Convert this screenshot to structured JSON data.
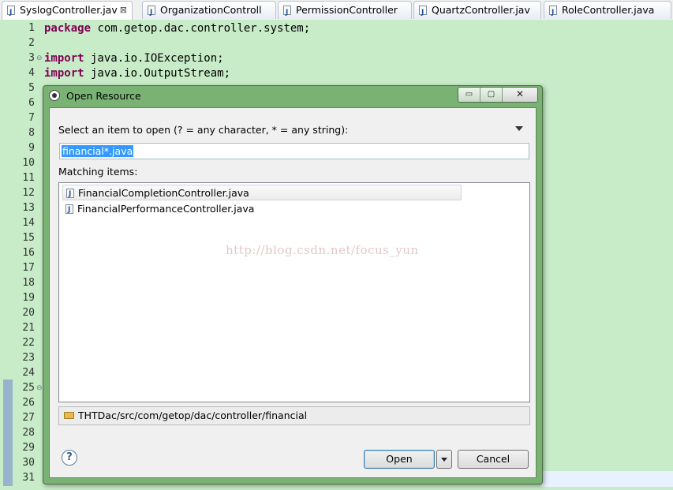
{
  "tabs": [
    {
      "label": "SyslogController.jav",
      "active": true,
      "close": "⊠"
    },
    {
      "label": "OrganizationControll"
    },
    {
      "label": "PermissionController"
    },
    {
      "label": "QuartzController.jav"
    },
    {
      "label": "RoleController.java"
    }
  ],
  "editor": {
    "line_numbers": [
      "1",
      "2",
      "3",
      "4",
      "5",
      "6",
      "7",
      "8",
      "9",
      "10",
      "11",
      "12",
      "13",
      "14",
      "15",
      "16",
      "17",
      "18",
      "19",
      "20",
      "21",
      "22",
      "23",
      "24",
      "25",
      "26",
      "27",
      "28",
      "29",
      "30",
      "31"
    ],
    "lines": [
      {
        "kw": "package",
        "text": " com.getop.dac.controller.system;"
      },
      {
        "kw": "import",
        "text": " java.io.IOException;"
      },
      {
        "kw": "import",
        "text": " java.io.OutputStream;"
      }
    ]
  },
  "dialog": {
    "title": "Open Resource",
    "window_buttons": {
      "minimize": "▭",
      "maximize": "▢",
      "close": "✕"
    },
    "prompt_label": "Select an item to open (? = any character, * = any string):",
    "pattern_value": "financial*.java",
    "matching_label": "Matching items:",
    "items": [
      "FinancialCompletionController.java",
      "FinancialPerformanceController.java"
    ],
    "watermark": "http://blog.csdn.net/focus_yun",
    "status_path": "THTDac/src/com/getop/dac/controller/financial",
    "help": "?",
    "open_label": "Open",
    "cancel_label": "Cancel"
  }
}
